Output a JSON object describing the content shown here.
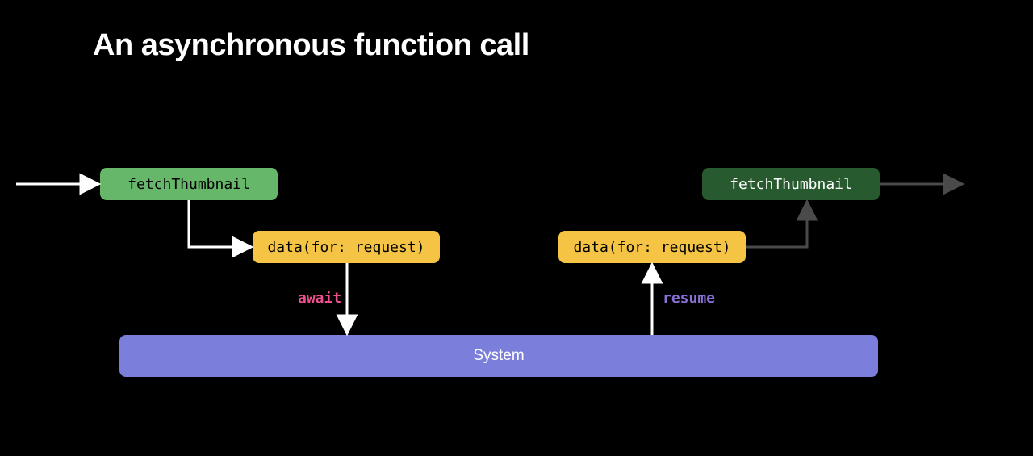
{
  "title": "An asynchronous function call",
  "boxes": {
    "fetch1": "fetchThumbnail",
    "fetch2": "fetchThumbnail",
    "data1": "data(for: request)",
    "data2": "data(for: request)",
    "system": "System"
  },
  "labels": {
    "await": "await",
    "resume": "resume"
  }
}
